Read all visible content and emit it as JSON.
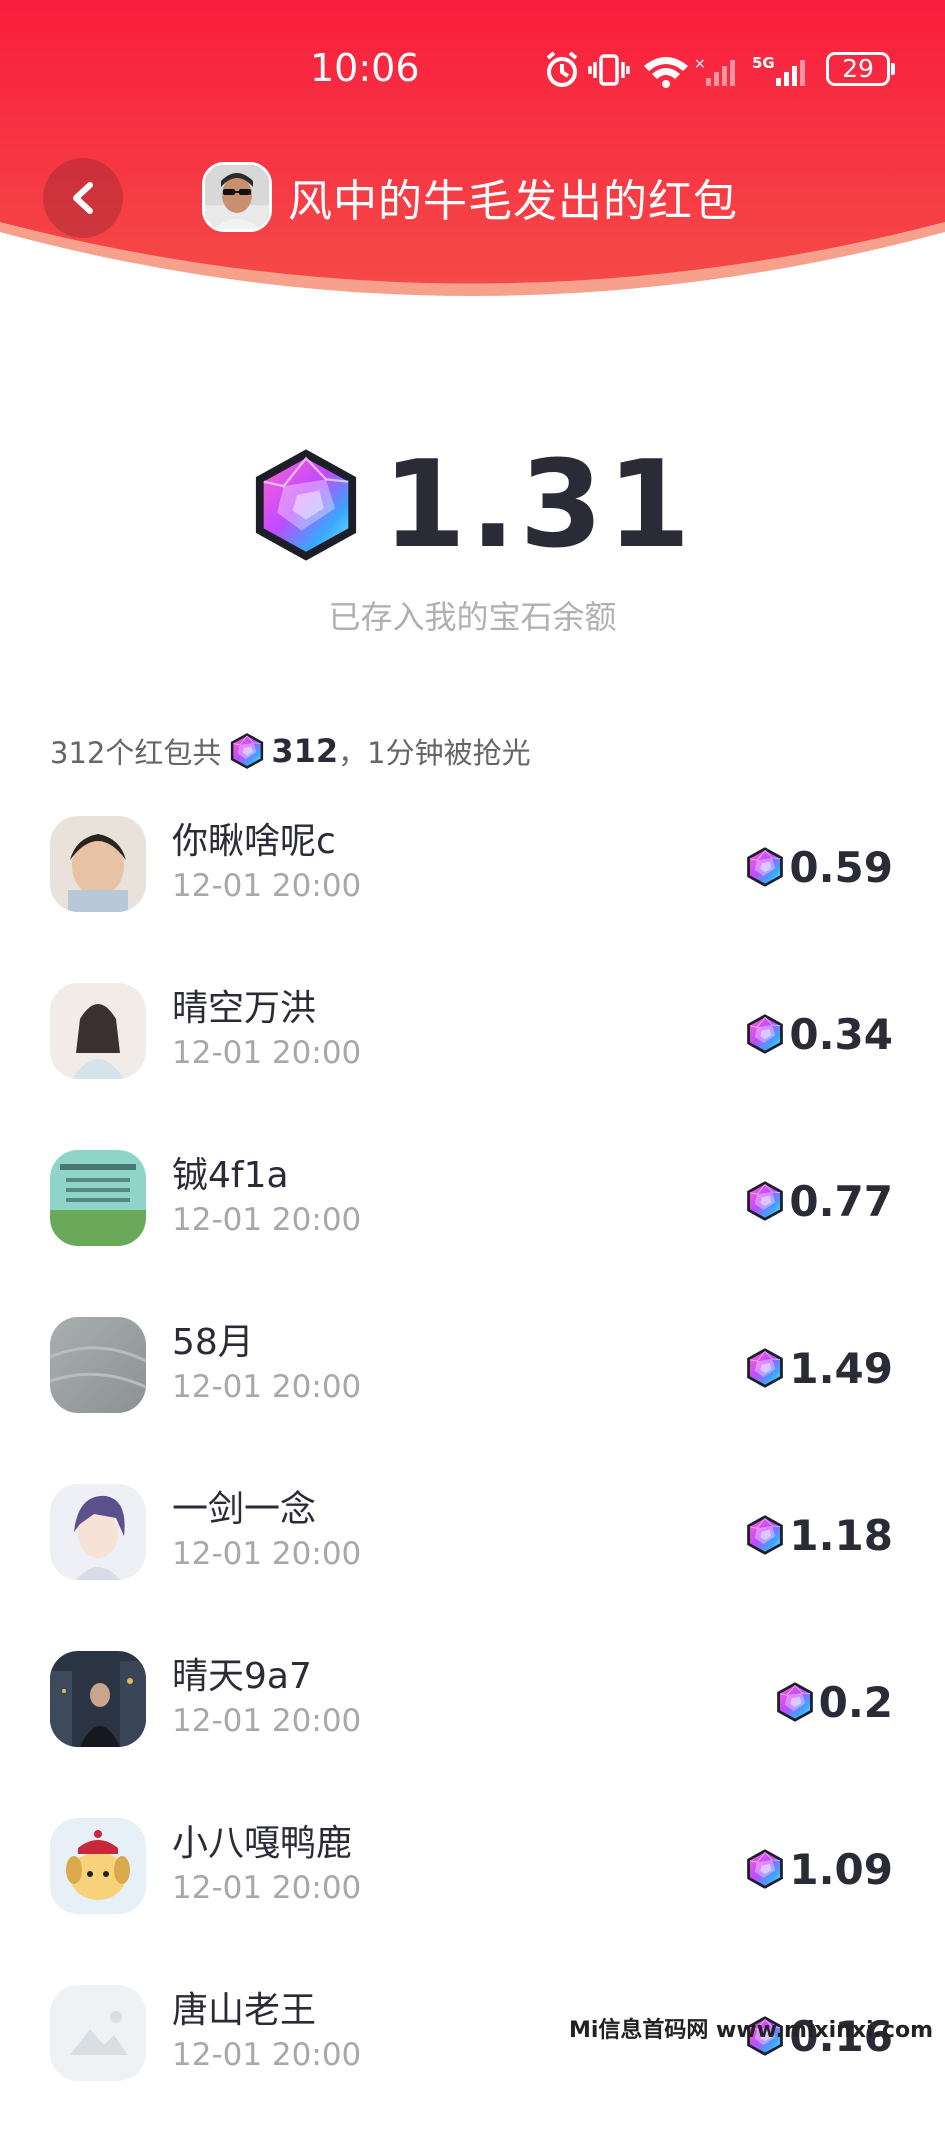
{
  "status_bar": {
    "time": "10:06",
    "icons": [
      "alarm-icon",
      "vibrate-icon",
      "wifi-icon",
      "signal-icon",
      "5g-signal-icon"
    ],
    "battery": "29"
  },
  "header": {
    "title": "风中的牛毛发出的红包",
    "back_icon": "chevron-left-icon",
    "colors": {
      "top": "#f81f3e",
      "bottom": "#f4514a",
      "edge": "#f7a08b"
    }
  },
  "amount": {
    "value": "1.31",
    "subtitle": "已存入我的宝石余额"
  },
  "summary": {
    "prefix": "312个红包共",
    "total": "312",
    "suffix": "，1分钟被抢光"
  },
  "list": [
    {
      "name": "你瞅啥呢c",
      "time": "12-01 20:00",
      "amount": "0.59"
    },
    {
      "name": "晴空万洪",
      "time": "12-01 20:00",
      "amount": "0.34"
    },
    {
      "name": "铖4f1a",
      "time": "12-01 20:00",
      "amount": "0.77"
    },
    {
      "name": "58月",
      "time": "12-01 20:00",
      "amount": "1.49"
    },
    {
      "name": "一剑一念",
      "time": "12-01 20:00",
      "amount": "1.18"
    },
    {
      "name": "晴天9a7",
      "time": "12-01 20:00",
      "amount": "0.2"
    },
    {
      "name": "小八嘎鸭鹿",
      "time": "12-01 20:00",
      "amount": "1.09"
    },
    {
      "name": "唐山老王",
      "time": "12-01 20:00",
      "amount": "0.16"
    }
  ],
  "watermark": "Mi信息首码网 www.mixinxi.com"
}
